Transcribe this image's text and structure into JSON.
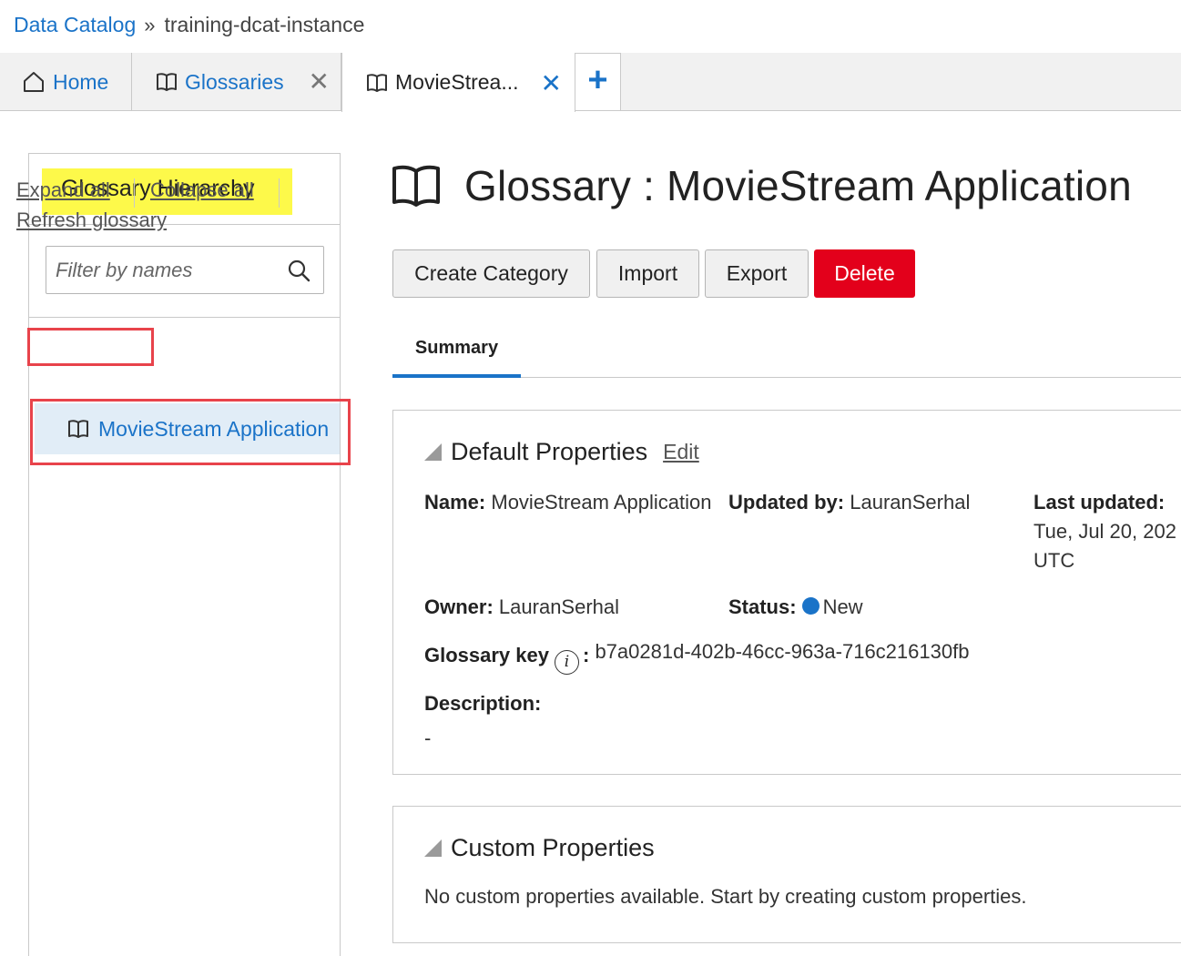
{
  "breadcrumb": {
    "root": "Data Catalog",
    "separator": "»",
    "current": "training-dcat-instance"
  },
  "tabs": {
    "home": "Home",
    "glossaries": "Glossaries",
    "active": "MovieStrea...",
    "close_symbol": "✕",
    "add_symbol": "+"
  },
  "left_panel": {
    "title": "Glossary Hierarchy",
    "filter_placeholder": "Filter by names",
    "expand_all": "Expand all",
    "collapse_all": "Collapse all",
    "refresh": "Refresh glossary",
    "tree_item": "MovieStream Application"
  },
  "main": {
    "title": "Glossary : MovieStream Application",
    "buttons": {
      "create_category": "Create Category",
      "import": "Import",
      "export": "Export",
      "delete": "Delete"
    },
    "tab_summary": "Summary",
    "default_properties": {
      "heading": "Default Properties",
      "edit": "Edit",
      "name_label": "Name:",
      "name_value": "MovieStream Application",
      "updated_by_label": "Updated by:",
      "updated_by_value": "LauranSerhal",
      "last_updated_label": "Last updated:",
      "last_updated_value": "Tue, Jul 20, 202",
      "last_updated_tz": "UTC",
      "owner_label": "Owner:",
      "owner_value": "LauranSerhal",
      "status_label": "Status:",
      "status_value": "New",
      "glossary_key_label": "Glossary key",
      "glossary_key_colon": ":",
      "glossary_key_value": "b7a0281d-402b-46cc-963a-716c216130fb",
      "description_label": "Description:",
      "description_value": "-"
    },
    "custom_properties": {
      "heading": "Custom Properties",
      "message": "No custom properties available. Start by creating custom properties."
    }
  },
  "colors": {
    "accent": "#1a73c8",
    "delete": "#e3001b",
    "highlight": "#fdf94a",
    "annotation": "#e8434b",
    "selected_row": "#e1edf7"
  }
}
